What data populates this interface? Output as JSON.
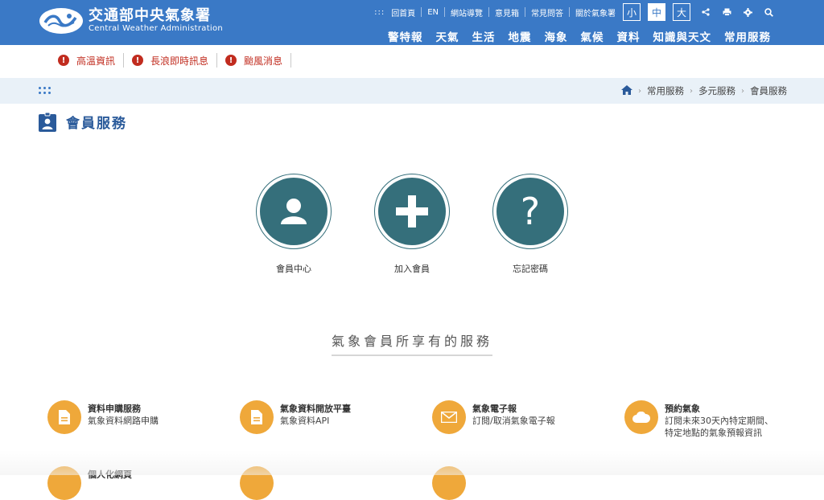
{
  "header": {
    "logo_title": "交通部中央氣象署",
    "logo_sub": "Central Weather Administration",
    "util_dots": ":::",
    "util_links": [
      "回首頁",
      "EN",
      "網站導覽",
      "意見箱",
      "常見問答",
      "關於氣象署"
    ],
    "font_sizes": [
      "小",
      "中",
      "大"
    ],
    "active_font": "中",
    "nav": [
      "警特報",
      "天氣",
      "生活",
      "地震",
      "海象",
      "氣候",
      "資料",
      "知識與天文",
      "常用服務"
    ]
  },
  "alerts": [
    "高溫資訊",
    "長浪即時訊息",
    "颱風消息"
  ],
  "breadcrumb": [
    "常用服務",
    "多元服務",
    "會員服務"
  ],
  "page_title": "會員服務",
  "actions": [
    {
      "label": "會員中心",
      "icon": "user-icon"
    },
    {
      "label": "加入會員",
      "icon": "plus-icon"
    },
    {
      "label": "忘記密碼",
      "icon": "question-icon"
    }
  ],
  "section_title": "氣象會員所享有的服務",
  "services": [
    {
      "title": "資料申購服務",
      "desc": "氣象資料網路申購",
      "icon": "document-icon"
    },
    {
      "title": "氣象資料開放平臺",
      "desc": "氣象資料API",
      "icon": "document-icon"
    },
    {
      "title": "氣象電子報",
      "desc": "訂閱/取消氣象電子報",
      "icon": "mail-icon"
    },
    {
      "title": "預約氣象",
      "desc": "訂閱未來30天內特定期間、特定地點的氣象預報資訊",
      "desc_line1": "訂閱未來30天內特定期間、",
      "desc_line2": "特定地點的氣象預報資訊",
      "icon": "cloud-icon"
    },
    {
      "title": "個人化網頁",
      "desc": "",
      "icon": "document-icon"
    }
  ],
  "colors": {
    "header": "#3a79c6",
    "teal": "#356f7b",
    "orange": "#efa83a",
    "alert": "#c12c1f"
  }
}
